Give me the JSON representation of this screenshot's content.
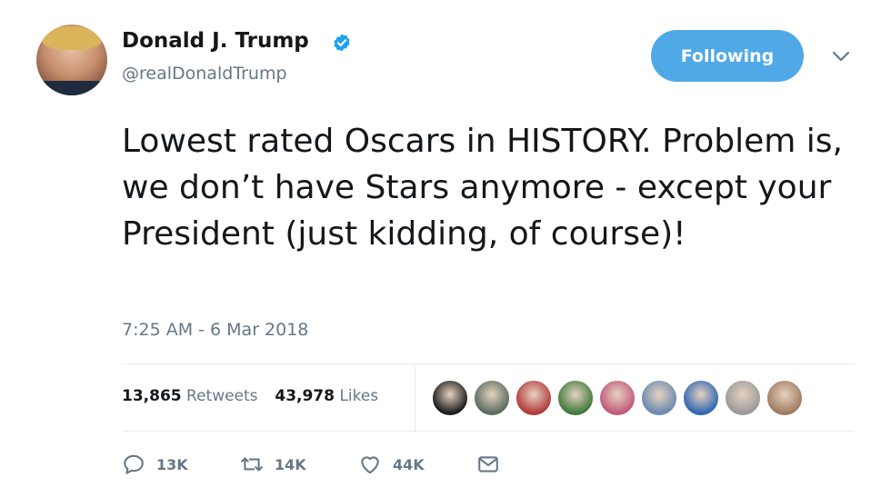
{
  "author": {
    "name": "Donald J. Trump",
    "handle": "@realDonaldTrump",
    "verified_icon": "verified-badge-icon",
    "avatar_icon": "profile-avatar"
  },
  "follow_button": {
    "label": "Following"
  },
  "menu_icon": "chevron-down-icon",
  "tweet": {
    "text": "Lowest rated Oscars in HISTORY. Problem is, we don’t have Stars anymore - except your President (just kidding, of course)!",
    "timestamp": "7:25 AM - 6 Mar 2018"
  },
  "stats": {
    "retweets_count": "13,865",
    "retweets_label": "Retweets",
    "likes_count": "43,978",
    "likes_label": "Likes"
  },
  "liker_avatars": [
    "#1b1b1b",
    "#5a6b5e",
    "#b33a3a",
    "#3f7a3a",
    "#c05a7a",
    "#6a8ab0",
    "#2f66b3",
    "#9a9a9a",
    "#a07a60"
  ],
  "actions": {
    "reply_count": "13K",
    "retweet_count": "14K",
    "like_count": "44K"
  },
  "colors": {
    "accent": "#4fa9e6",
    "text": "#14171a",
    "secondary": "#657786"
  }
}
